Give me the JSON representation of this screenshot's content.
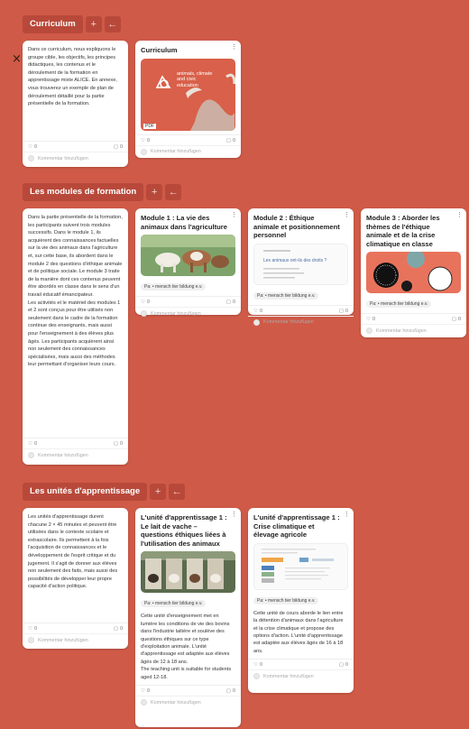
{
  "sections": [
    {
      "title": "Curriculum",
      "text_card": {
        "text": "Dans ce curriculum, nous expliquons le groupe cible, les objectifs, les principes didactiques, les contenus et le déroulement de la formation en apprentissage mixte ALICE. En annexe, vous trouverez un exemple de plan de déroulement détaillé pour la partie présentielle de la formation.",
        "likes": "0",
        "comments": "0",
        "comment_placeholder": "Kommentar hinzufügen"
      },
      "cards": [
        {
          "title": "Curriculum",
          "thumb": "curriculum-pdf",
          "thumb_text": "animals, climate and civic education",
          "tag": "PDF",
          "likes": "0",
          "comments": "0",
          "comment_placeholder": "Kommentar hinzufügen"
        }
      ]
    },
    {
      "title": "Les modules de formation",
      "text_card": {
        "text": "Dans la partie présentielle de la formation, les participants suivent trois modules successifs. Dans le module 1, ils acquièrent des connaissances factuelles sur la vie des animaux dans l'agriculture et, sur cette base, ils abordent dans le module 2 des questions d'éthique animale et de politique sociale. Le module 3 traite de la manière dont ces contenus peuvent être abordés en classe dans le sens d'un travail éducatif émancipateur.\nLes activités et le matériel des modules 1 et 2 sont conçus pour être utilisés non seulement dans le cadre de la formation continue des enseignants, mais aussi pour l'enseignement à des élèves plus âgés. Les participants acquièrent ainsi non seulement des connaissances spécialisées, mais aussi des méthodes leur permettant d'organiser leurs cours.",
        "likes": "0",
        "comments": "0",
        "comment_placeholder": "Kommentar hinzufügen"
      },
      "cards": [
        {
          "title": "Module 1 : La vie des animaux dans l'agriculture",
          "thumb": "cows",
          "pill": "Pa: • mensch tier bildung e.v.",
          "likes": "0",
          "comments": "0",
          "comment_placeholder": "Kommentar hinzufügen"
        },
        {
          "title": "Module 2 : Éthique animale et positionnement personnel",
          "thumb": "doc-slide",
          "thumb_line1": "Les animaux ont-ils des droits ?",
          "pill": "Pa: • mensch tier bildung e.v.",
          "likes": "0",
          "comments": "0",
          "comment_placeholder": "Kommentar hinzufügen"
        },
        {
          "title": "Module 3 : Aborder les thèmes de l'éthique animale et de la crise climatique en classe",
          "thumb": "circles",
          "pill": "Pa: • mensch tier bildung e.v.",
          "likes": "0",
          "comments": "0",
          "comment_placeholder": "Kommentar hinzufügen"
        }
      ]
    },
    {
      "title": "Les unités d'apprentissage",
      "text_card": {
        "text": "Les unités d'apprentissage durent chacune 2 × 45 minutes et peuvent être utilisées dans le contexte scolaire et extrascolaire. Ils permettent à la fois l'acquisition de connaissances et le développement de l'esprit critique et du jugement. Il s'agit de donner aux élèves non seulement des faits, mais aussi des possibilités de développer leur propre capacité d'action politique.",
        "likes": "0",
        "comments": "0",
        "comment_placeholder": "Kommentar hinzufügen"
      },
      "cards": [
        {
          "title": "L'unité d'apprentissage 1 : Le lait de vache – questions éthiques liées à l'utilisation des animaux",
          "thumb": "calves",
          "pill": "Pa: • mensch tier bildung e.v.",
          "desc": "Cette unité d'enseignement met en lumière les conditions de vie des bovins dans l'industrie laitière et soulève des questions éthiques sur ce type d'exploitation animale. L'unité d'apprentissage est adaptée aux élèves âgés de 12 à 18 ans.\nThe teaching unit is suitable for students aged 12-18.",
          "likes": "0",
          "comments": "0",
          "comment_placeholder": "Kommentar hinzufügen"
        },
        {
          "title": "L'unité d'apprentissage 1 : Crise climatique et élevage agricole",
          "thumb": "doc-logos",
          "pill": "Pa: • mensch tier bildung e.v.",
          "desc": "Cette unité de cours aborde le lien entre la détention d'animaux dans l'agriculture et la crise climatique et propose des options d'action. L'unité d'apprentissage est adaptée aux élèves âgés de 16 à 18 ans.",
          "likes": "0",
          "comments": "0",
          "comment_placeholder": "Kommentar hinzufügen"
        }
      ]
    }
  ],
  "close_mark": "×",
  "add_glyph": "+",
  "back_glyph": "←",
  "menu_glyph": "⋮",
  "icons": {
    "like": "heart-icon",
    "comment": "comment-icon",
    "menu": "more-vertical-icon"
  },
  "colors": {
    "background": "#cf5a47",
    "section_chip": "#b8493a",
    "thumb_orange": "#d9604a",
    "card": "#ffffff"
  }
}
